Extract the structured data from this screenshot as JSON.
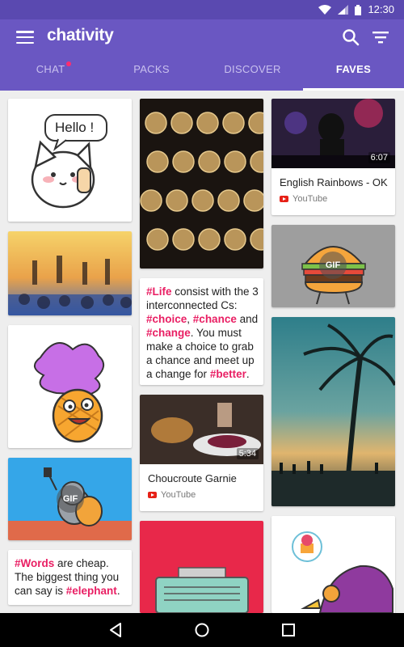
{
  "status_bar": {
    "time": "12:30",
    "icons": [
      "wifi-icon",
      "signal-icon",
      "battery-icon"
    ]
  },
  "app_bar": {
    "brand": "chativity",
    "icons": [
      "menu-icon",
      "search-icon",
      "filter-icon"
    ],
    "colors": {
      "primary": "#6a57c2",
      "status": "#5a49b0",
      "accent": "#e91e63"
    }
  },
  "tabs": [
    {
      "label": "CHAT",
      "has_notification": true
    },
    {
      "label": "PACKS"
    },
    {
      "label": "DISCOVER"
    },
    {
      "label": "FAVES",
      "active": true
    }
  ],
  "cards": {
    "video1": {
      "title": "English Rainbows - OK",
      "source": "YouTube",
      "duration": "6:07"
    },
    "video2": {
      "title": "Choucroute Garnie",
      "source": "YouTube",
      "duration": "5:34"
    },
    "quote1": {
      "parts": [
        {
          "t": "#Life",
          "tag": true
        },
        {
          "t": " consist with the 3 interconnected Cs: "
        },
        {
          "t": "#choice",
          "tag": true
        },
        {
          "t": ", "
        },
        {
          "t": "#chance",
          "tag": true
        },
        {
          "t": " and "
        },
        {
          "t": "#change",
          "tag": true
        },
        {
          "t": ". You must make a choice to grab a chance and meet up a change for "
        },
        {
          "t": "#better",
          "tag": true
        },
        {
          "t": "."
        }
      ]
    },
    "quote2": {
      "parts": [
        {
          "t": "#Words",
          "tag": true
        },
        {
          "t": " are cheap. The biggest thing you can say is "
        },
        {
          "t": "#elephant",
          "tag": true
        },
        {
          "t": "."
        }
      ]
    },
    "sticker_hello": {
      "text": "Hello !"
    },
    "gif_labels": {
      "burger": "GIF",
      "cat": "GIF"
    }
  },
  "nav_bar": {
    "icons": [
      "back-icon",
      "home-icon",
      "recents-icon"
    ]
  }
}
